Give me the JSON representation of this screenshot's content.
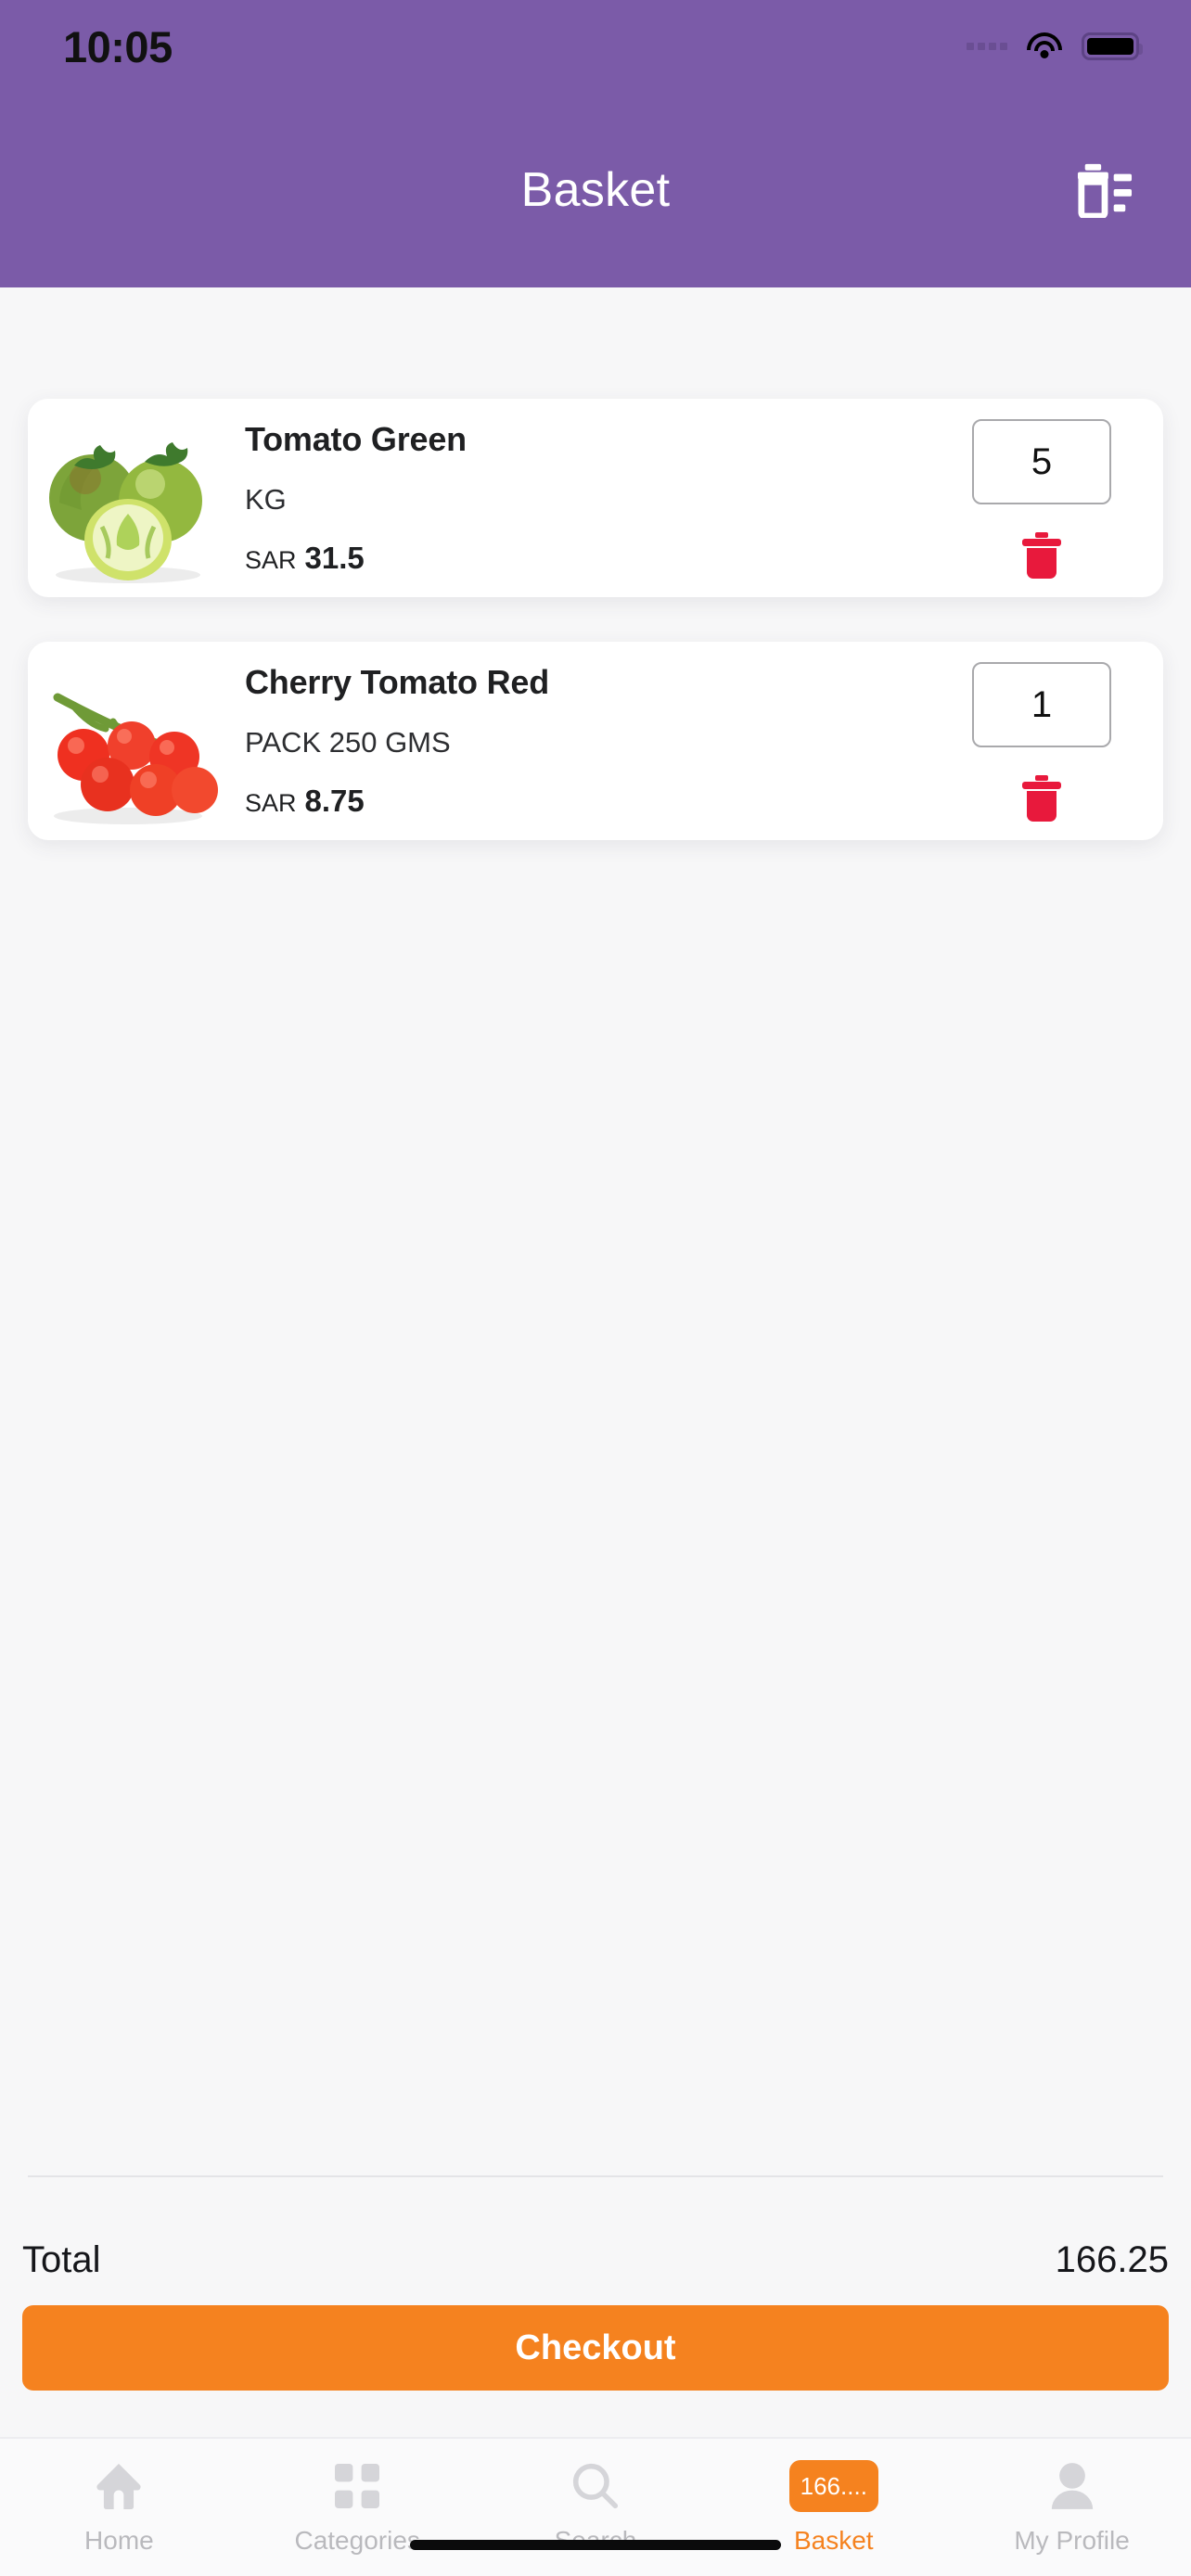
{
  "status_bar": {
    "time": "10:05",
    "signal_icon": "signal-dots-icon",
    "wifi_icon": "wifi-icon",
    "battery_icon": "battery-full-icon"
  },
  "header": {
    "title": "Basket",
    "background_color": "#7B5BA8",
    "clear_basket_icon": "clear-list-trash-icon"
  },
  "basket": {
    "items": [
      {
        "name": "Tomato Green",
        "unit": "KG",
        "currency": "SAR",
        "price": "31.5",
        "quantity": "5",
        "image_icon": "green-tomatoes-image",
        "delete_icon": "trash-icon"
      },
      {
        "name": "Cherry Tomato Red",
        "unit": "PACK 250 GMS",
        "currency": "SAR",
        "price": "8.75",
        "quantity": "1",
        "image_icon": "red-cherry-tomatoes-image",
        "delete_icon": "trash-icon"
      }
    ]
  },
  "summary": {
    "total_label": "Total",
    "total_value": "166.25",
    "checkout_label": "Checkout",
    "checkout_color": "#F5821F"
  },
  "tabbar": {
    "items": [
      {
        "label": "Home",
        "icon": "home-icon",
        "active": false
      },
      {
        "label": "Categories",
        "icon": "grid-icon",
        "active": false
      },
      {
        "label": "Search",
        "icon": "search-icon",
        "active": false
      },
      {
        "label": "Basket",
        "icon": "basket-badge",
        "active": true,
        "badge": "166...."
      },
      {
        "label": "My Profile",
        "icon": "person-icon",
        "active": false
      }
    ],
    "active_color": "#F5821F",
    "inactive_color": "#B9B9BD"
  },
  "accent": {
    "trash_red": "#E8193C",
    "orange": "#F5821F",
    "purple": "#7B5BA8"
  }
}
